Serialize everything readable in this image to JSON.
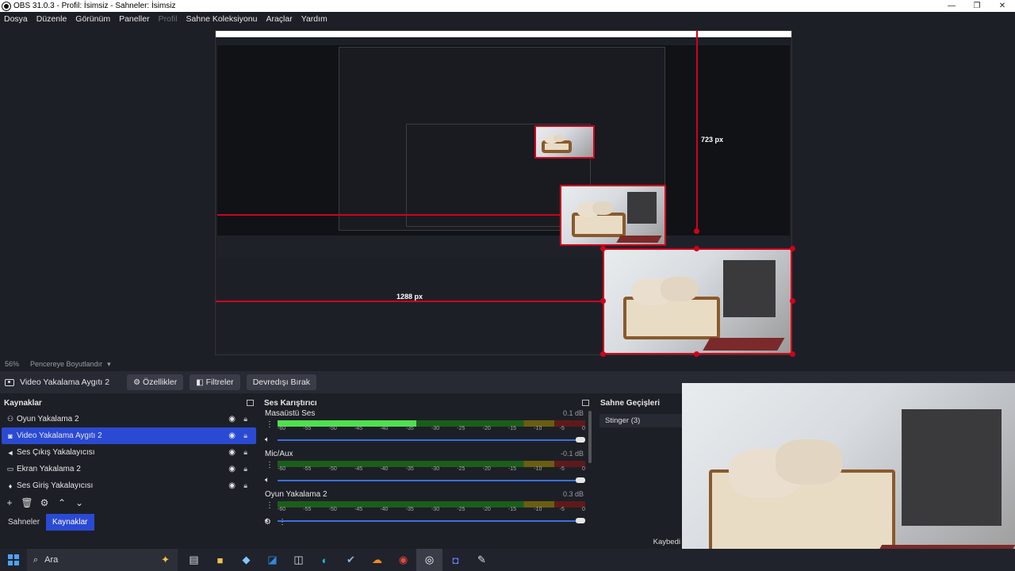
{
  "window": {
    "title": "OBS 31.0.3 - Profil: İsimsiz - Sahneler: İsimsiz",
    "minimize": "—",
    "restore": "❐",
    "close": "✕"
  },
  "menu": [
    {
      "label": "Dosya",
      "enabled": true
    },
    {
      "label": "Düzenle",
      "enabled": true
    },
    {
      "label": "Görünüm",
      "enabled": true
    },
    {
      "label": "Paneller",
      "enabled": true
    },
    {
      "label": "Profil",
      "enabled": false
    },
    {
      "label": "Sahne Koleksiyonu",
      "enabled": true
    },
    {
      "label": "Araçlar",
      "enabled": true
    },
    {
      "label": "Yardım",
      "enabled": true
    }
  ],
  "preview": {
    "width_label": "1288 px",
    "height_label": "723 px"
  },
  "zoom": {
    "value": "56%",
    "mode": "Pencereye Boyutlandır"
  },
  "source_toolbar": {
    "source_name": "Video Yakalama Aygıtı 2",
    "properties": "Özellikler",
    "filters": "Filtreler",
    "deactivate": "Devredışı Bırak"
  },
  "sources": {
    "title": "Kaynaklar",
    "items": [
      {
        "label": "Oyun Yakalama 2",
        "icon": "gamepad-icon",
        "glyph": "⚇",
        "selected": false
      },
      {
        "label": "Video Yakalama Aygıtı 2",
        "icon": "camera-icon",
        "glyph": "◙",
        "selected": true
      },
      {
        "label": "Ses Çıkış Yakalayıcısı",
        "icon": "speaker-icon",
        "glyph": "🔊",
        "selected": false
      },
      {
        "label": "Ekran Yakalama 2",
        "icon": "monitor-icon",
        "glyph": "▭",
        "selected": false
      },
      {
        "label": "Ses Giriş Yakalayıcısı",
        "icon": "microphone-icon",
        "glyph": "🎙",
        "selected": false
      }
    ],
    "tabs": [
      "Sahneler",
      "Kaynaklar"
    ],
    "active_tab": "Kaynaklar"
  },
  "mixer": {
    "title": "Ses Karıştırıcı",
    "scale": [
      "-60",
      "-55",
      "-50",
      "-45",
      "-40",
      "-35",
      "-30",
      "-25",
      "-20",
      "-15",
      "-10",
      "-5",
      "0"
    ],
    "channels": [
      {
        "name": "Masaüstü Ses",
        "db": "0.1 dB",
        "level": 0.45,
        "volume": 1.0
      },
      {
        "name": "Mic/Aux",
        "db": "-0.1 dB",
        "level": 0.0,
        "volume": 1.0
      },
      {
        "name": "Oyun Yakalama 2",
        "db": "0.3 dB",
        "level": 0.0,
        "volume": 1.0
      }
    ]
  },
  "transitions": {
    "title": "Sahne Geçişleri",
    "selected": "Stinger (3)"
  },
  "status": {
    "record": "Kaybedi"
  },
  "taskbar": {
    "search_placeholder": "Ara"
  },
  "colors": {
    "accent": "#2b4ad3",
    "guide_red": "#d0021b",
    "meter_green": "#4ee04e"
  }
}
